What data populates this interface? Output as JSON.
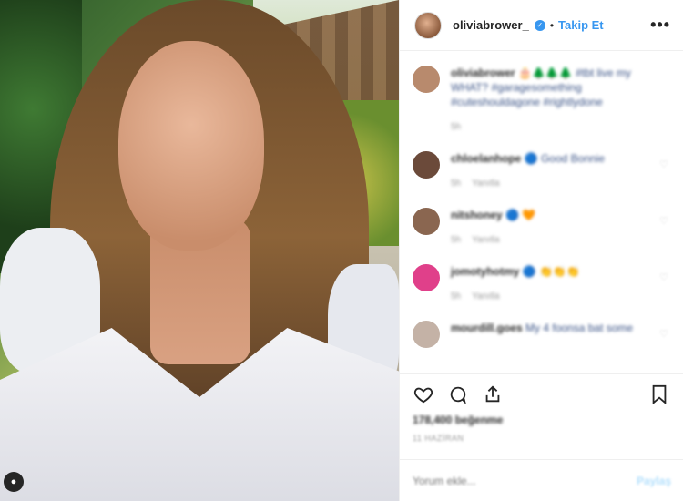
{
  "post": {
    "username": "oliviabrower_",
    "separator": "•",
    "follow_label": "Takip Et",
    "more_label": "•••",
    "colors": {
      "accent": "#3897f0",
      "verified": "#3897f0",
      "text": "#262626"
    }
  },
  "comments": [
    {
      "user": "oliviabrower",
      "text": "🎂🌲🌲🌲 #tbt live my WHAT? #garagesomething #cuteshouldagone #rightlydone",
      "meta": [
        "5h"
      ],
      "avatar_color": "#b88a6d"
    },
    {
      "user": "chloelanhope",
      "text": "🔵 Good Bonnie",
      "meta": [
        "5h",
        "Yanıtla"
      ],
      "avatar_color": "#6b4a3a"
    },
    {
      "user": "nitshoney",
      "text": "🔵 🧡",
      "meta": [
        "5h",
        "Yanıtla"
      ],
      "avatar_color": "#8a6650"
    },
    {
      "user": "jomotyhotmy",
      "text": "🔵 👏👏👏",
      "meta": [
        "5h",
        "Yanıtla"
      ],
      "avatar_color": "#e0408a"
    },
    {
      "user": "mourdill.goes",
      "text": "My 4 foonsa bat some",
      "meta": [],
      "avatar_color": "#c4b2a6"
    }
  ],
  "actions": {
    "icons": [
      "heart-icon",
      "comment-icon",
      "share-icon",
      "bookmark-icon"
    ]
  },
  "likes": "178,400 beğenme",
  "timestamp": "11 HAZİRAN",
  "add_comment": {
    "placeholder": "Yorum ekle...",
    "post_label": "Paylaş"
  }
}
